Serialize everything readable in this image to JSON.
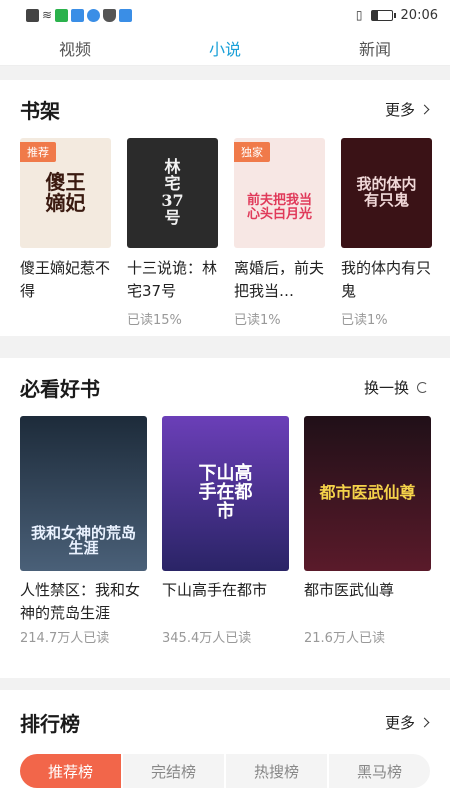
{
  "status_bar": {
    "time": "20:06",
    "icons": [
      "notification-icon",
      "wifi-icon",
      "wechat-icon",
      "cloud-icon",
      "bulb-icon",
      "shield-icon",
      "cloud-icon",
      "vibrate-icon",
      "battery-icon"
    ],
    "battery_level": 0.3
  },
  "top_tabs": [
    {
      "label": "视频",
      "active": false
    },
    {
      "label": "小说",
      "active": true
    },
    {
      "label": "新闻",
      "active": false
    }
  ],
  "shelf": {
    "title": "书架",
    "more": "更多",
    "items": [
      {
        "title": "傻王嫡妃惹不得",
        "meta": "",
        "badge": "推荐",
        "cover_text": "傻王嫡妃",
        "cover_bg": "#f3eadf",
        "cover_fg": "#3a1a10"
      },
      {
        "title": "十三说诡：林宅37号",
        "meta": "已读15%",
        "badge": "",
        "cover_text": "林宅37号",
        "cover_bg": "#2b2b2b",
        "cover_fg": "#f2f2f2"
      },
      {
        "title": "离婚后，前夫把我当…",
        "meta": "已读1%",
        "badge": "独家",
        "cover_text": "前夫把我当心头白月光",
        "cover_bg": "#f7e7e4",
        "cover_fg": "#e03a5a"
      },
      {
        "title": "我的体内有只鬼",
        "meta": "已读1%",
        "badge": "",
        "cover_text": "我的体内有只鬼",
        "cover_bg": "#3a1216",
        "cover_fg": "#f0d8d8"
      }
    ]
  },
  "must_read": {
    "title": "必看好书",
    "more": "换一换",
    "items": [
      {
        "title": "人性禁区：我和女神的荒岛生涯",
        "meta": "214.7万人已读",
        "cover_text": "我和女神的荒岛生涯",
        "cover_bg": "#2a3d52",
        "cover_fg": "#eaf2ff"
      },
      {
        "title": "下山高手在都市",
        "meta": "345.4万人已读",
        "cover_text": "下山高手在都市",
        "cover_bg": "#3b2f8c",
        "cover_fg": "#ffffff"
      },
      {
        "title": "都市医武仙尊",
        "meta": "21.6万人已读",
        "cover_text": "都市医武仙尊",
        "cover_bg": "#3a1020",
        "cover_fg": "#f5d34a"
      }
    ]
  },
  "ranking": {
    "title": "排行榜",
    "more": "更多",
    "tabs": [
      {
        "label": "推荐榜",
        "active": true
      },
      {
        "label": "完结榜",
        "active": false
      },
      {
        "label": "热搜榜",
        "active": false
      },
      {
        "label": "黑马榜",
        "active": false
      }
    ]
  },
  "colors": {
    "accent": "#1aa0d8",
    "rank_active": "#f2664a",
    "badge": "#f07a4a"
  }
}
